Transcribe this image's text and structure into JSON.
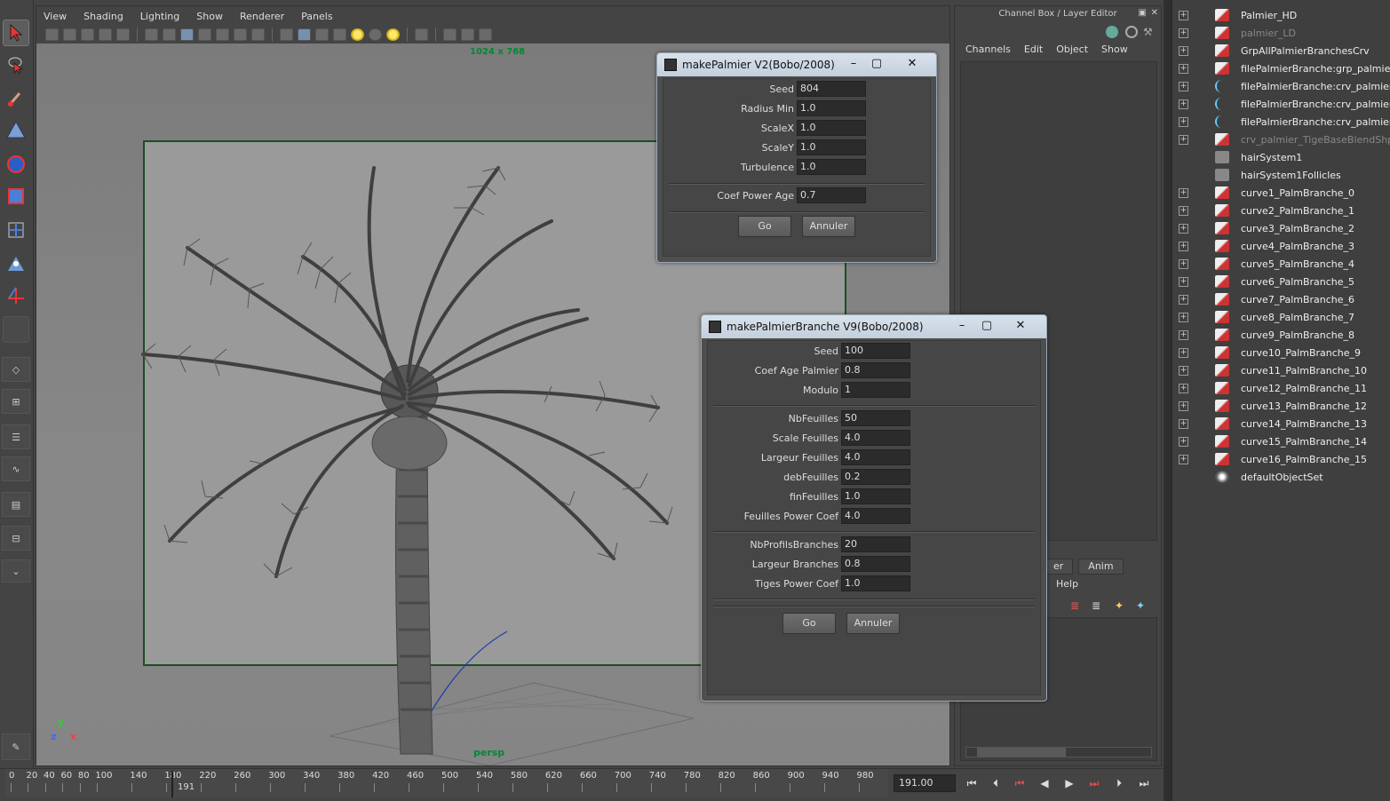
{
  "viewport": {
    "menu": [
      "View",
      "Shading",
      "Lighting",
      "Show",
      "Renderer",
      "Panels"
    ],
    "resolution": "1024 x 768",
    "camera": "persp",
    "axes": {
      "y": "y",
      "z": "z",
      "x": "x"
    }
  },
  "win1": {
    "title": "makePalmier V2(Bobo/2008)",
    "fields": [
      {
        "label": "Seed",
        "value": "804"
      },
      {
        "label": "Radius Min",
        "value": "1.0"
      },
      {
        "label": "ScaleX",
        "value": "1.0"
      },
      {
        "label": "ScaleY",
        "value": "1.0"
      },
      {
        "label": "Turbulence",
        "value": "1.0"
      },
      {
        "label": "Coef Power Age",
        "value": "0.7"
      }
    ],
    "go": "Go",
    "cancel": "Annuler"
  },
  "win2": {
    "title": "makePalmierBranche V9(Bobo/2008)",
    "fields": [
      {
        "label": "Seed",
        "value": "100"
      },
      {
        "label": "Coef Age Palmier",
        "value": "0.8"
      },
      {
        "label": "Modulo",
        "value": "1"
      },
      {
        "label": "NbFeuilles",
        "value": "50"
      },
      {
        "label": "Scale Feuilles",
        "value": "4.0"
      },
      {
        "label": "Largeur Feuilles",
        "value": "4.0"
      },
      {
        "label": "debFeuilles",
        "value": "0.2"
      },
      {
        "label": "finFeuilles",
        "value": "1.0"
      },
      {
        "label": "Feuilles Power Coef",
        "value": "4.0"
      },
      {
        "label": "NbProfilsBranches",
        "value": "20"
      },
      {
        "label": "Largeur Branches",
        "value": "0.8"
      },
      {
        "label": "Tiges Power Coef",
        "value": "1.0"
      }
    ],
    "go": "Go",
    "cancel": "Annuler"
  },
  "channelbox": {
    "title": "Channel Box / Layer Editor",
    "menu": [
      "Channels",
      "Edit",
      "Object",
      "Show"
    ],
    "layer_tabs": [
      "er",
      "Anim"
    ],
    "layer_help": "Help"
  },
  "outliner": {
    "items": [
      {
        "label": "Palmier_HD",
        "dim": false
      },
      {
        "label": "palmier_LD",
        "dim": true
      },
      {
        "label": "GrpAllPalmierBranchesCrv",
        "dim": false
      },
      {
        "label": "filePalmierBranche:grp_palmier_fe",
        "dim": false
      },
      {
        "label": "filePalmierBranche:crv_palmier_br",
        "dim": false
      },
      {
        "label": "filePalmierBranche:crv_palmier_fe",
        "dim": false
      },
      {
        "label": "filePalmierBranche:crv_palmier_Tig",
        "dim": false
      },
      {
        "label": "crv_palmier_TigeBaseBlendShp",
        "dim": true
      },
      {
        "label": "hairSystem1",
        "dim": false
      },
      {
        "label": "hairSystem1Follicles",
        "dim": false
      },
      {
        "label": "curve1_PalmBranche_0",
        "dim": false
      },
      {
        "label": "curve2_PalmBranche_1",
        "dim": false
      },
      {
        "label": "curve3_PalmBranche_2",
        "dim": false
      },
      {
        "label": "curve4_PalmBranche_3",
        "dim": false
      },
      {
        "label": "curve5_PalmBranche_4",
        "dim": false
      },
      {
        "label": "curve6_PalmBranche_5",
        "dim": false
      },
      {
        "label": "curve7_PalmBranche_6",
        "dim": false
      },
      {
        "label": "curve8_PalmBranche_7",
        "dim": false
      },
      {
        "label": "curve9_PalmBranche_8",
        "dim": false
      },
      {
        "label": "curve10_PalmBranche_9",
        "dim": false
      },
      {
        "label": "curve11_PalmBranche_10",
        "dim": false
      },
      {
        "label": "curve12_PalmBranche_11",
        "dim": false
      },
      {
        "label": "curve13_PalmBranche_12",
        "dim": false
      },
      {
        "label": "curve14_PalmBranche_13",
        "dim": false
      },
      {
        "label": "curve15_PalmBranche_14",
        "dim": false
      },
      {
        "label": "curve16_PalmBranche_15",
        "dim": false
      },
      {
        "label": "defaultObjectSet",
        "dim": false
      }
    ]
  },
  "timeline": {
    "ticks": [
      "0",
      "20",
      "40",
      "60",
      "80",
      "100",
      "140",
      "180",
      "220",
      "260",
      "300",
      "340",
      "380",
      "420",
      "460",
      "500",
      "540",
      "580",
      "620",
      "660",
      "700",
      "740",
      "780",
      "820",
      "860",
      "900",
      "940",
      "980"
    ],
    "current_marker": "191",
    "current_frame": "191.00"
  }
}
